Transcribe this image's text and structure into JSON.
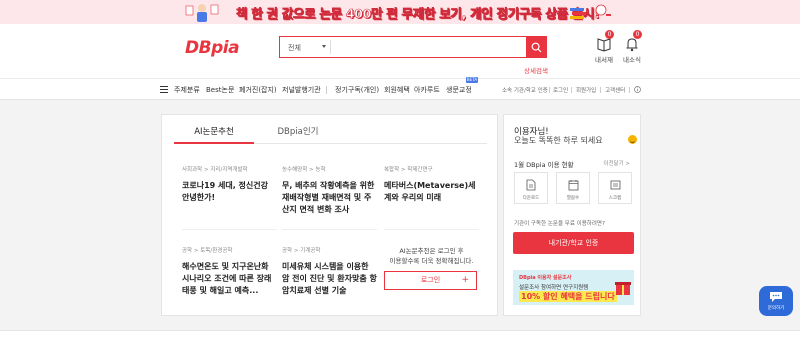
{
  "promo": {
    "text": "책 한 권 값으로 논문 400만 편 무제한 보기, 개인 정기구독 상품 출시!"
  },
  "header": {
    "logo": "DBpia",
    "search": {
      "scope": "전체",
      "placeholder": ""
    },
    "advanced_search": "상세검색",
    "icons": [
      {
        "name": "library-icon",
        "label": "내서재",
        "badge": "0"
      },
      {
        "name": "bell-icon",
        "label": "내소식",
        "badge": "0"
      }
    ]
  },
  "nav": {
    "items": [
      "주제분류",
      "Best논문",
      "폐거진(잡지)",
      "저널발행기관",
      "정기구독(개인)",
      "회원혜택",
      "아카루트",
      "생문교정"
    ],
    "beta": "BETA",
    "util": [
      "소속 기관/학교 인증",
      "로그인",
      "회원가입",
      "고객센터"
    ]
  },
  "main": {
    "tabs": [
      "AI논문추천",
      "DBpia인기"
    ],
    "cards": [
      {
        "category": "사회과학 > 지리/지역개발학",
        "title": "코로나19 세대, 정신건강 안녕한가!"
      },
      {
        "category": "농수해양학 > 농학",
        "title": "무, 배추의 작황예측을 위한 재배작형별 재배면적 및 주산지 면적 변화 조사"
      },
      {
        "category": "복합학 > 학제간연구",
        "title": "메타버스(Metaverse)세계와 우리의 미래"
      },
      {
        "category": "공학 > 토목/환경공학",
        "title": "해수면온도 및 지구온난화 시나리오 조건에 따른 장래 태풍 및 해일고 예측..."
      },
      {
        "category": "공학 > 기계공학",
        "title": "미세유체 시스템을 이용한 암 전이 진단 및 환자맞춤 항암치료제 선별 기술"
      }
    ],
    "login_prompt": [
      "AI논문추천은 로그인 후",
      "이용할수록 더욱 정확해집니다."
    ],
    "login_button": "로그인",
    "login_plus": "+"
  },
  "side": {
    "greeting": "이용자님!",
    "greeting2": "오늘도 똑똑한 하루 되세요",
    "usage_title": "1월 DBpia 이용 현황",
    "usage_more": "이전달기 >",
    "usage_boxes": [
      {
        "icon": "download-icon",
        "label": "다운로드"
      },
      {
        "icon": "calendar-icon",
        "label": "열람수"
      },
      {
        "icon": "scrap-icon",
        "label": "스크랩"
      }
    ],
    "org_question": "기관이 구독한 논문을 무료 이용하려면?",
    "org_button": "내기관/학교 인증",
    "ad": {
      "line1": "DBpia 이용자 설문조사",
      "line2": "설문조사 참여하면 연구지원템",
      "line3": "10% 할인 혜택을 드립니다"
    }
  },
  "chat": {
    "label": "문의하기"
  },
  "colors": {
    "accent": "#e8353f",
    "chat": "#2f6bd8"
  }
}
